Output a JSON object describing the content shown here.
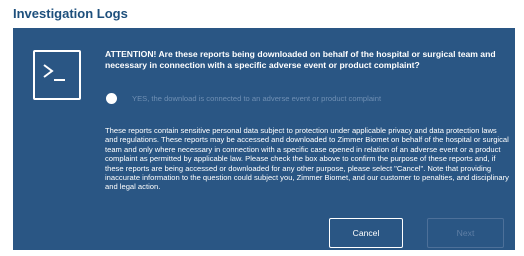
{
  "page": {
    "title": "Investigation Logs"
  },
  "dialog": {
    "icon": "terminal-icon",
    "attention": "ATTENTION! Are these reports being downloaded on behalf of the hospital or surgical team and necessary in connection with a specific adverse event or product complaint?",
    "radio_label": "YES, the download is connected to an adverse event or product complaint",
    "radio_checked": false,
    "body": "These reports contain sensitive personal data subject to protection under applicable privacy and data protection laws and regulations. These reports may be accessed and downloaded to Zimmer Biomet on behalf of the hospital or surgical team and only where necessary in connection with a specific case opened in relation of an adverse event or a product complaint as permitted by applicable law.  Please check the box above to confirm the purpose of these reports and, if these reports are being accessed or downloaded for any other purpose, please select \"Cancel\". Note that providing inaccurate information to the question could subject you, Zimmer Biomet, and our customer to penalties, and disciplinary and legal action.",
    "cancel_label": "Cancel",
    "next_label": "Next",
    "next_enabled": false
  },
  "colors": {
    "dialog_bg": "#2a5684",
    "title": "#1d4f7c",
    "disabled_text": "#6f8fb3"
  }
}
